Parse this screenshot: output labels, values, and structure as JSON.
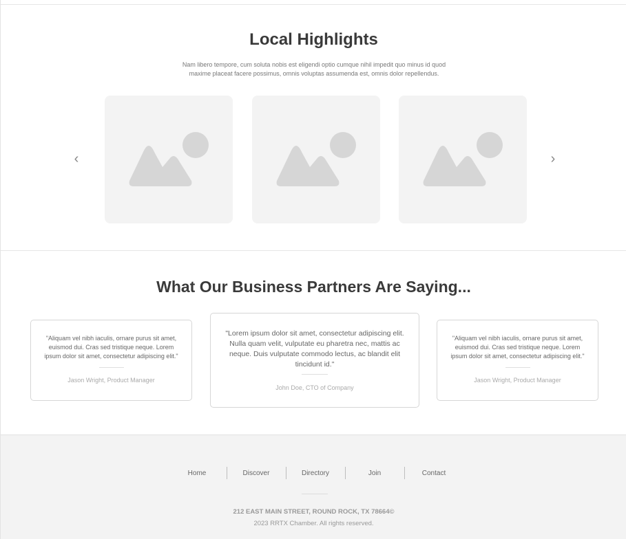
{
  "highlights": {
    "title": "Local Highlights",
    "subtitle": "Nam libero tempore, cum soluta nobis est eligendi optio cumque nihil impedit quo minus id quod maxime placeat facere possimus, omnis voluptas assumenda est, omnis dolor repellendus.",
    "prev_icon": "‹",
    "next_icon": "›",
    "image_icon": "image-placeholder-icon",
    "placeholder_color": "#d6d6d6",
    "card_color": "#f3f3f3"
  },
  "testimonials": {
    "title": "What Our Business Partners Are Saying...",
    "items": [
      {
        "quote": "\"Aliquam vel nibh iaculis, ornare purus sit amet, euismod dui. Cras sed tristique neque. Lorem ipsum dolor sit amet, consectetur adipiscing elit.\"",
        "author": "Jason Wright, Product Manager"
      },
      {
        "quote": "\"Lorem ipsum dolor sit amet, consectetur adipiscing elit. Nulla quam velit, vulputate eu pharetra nec, mattis ac neque. Duis vulputate commodo lectus, ac blandit elit tincidunt id.\"",
        "author": "John Doe, CTO of Company"
      },
      {
        "quote": "\"Aliquam vel nibh iaculis, ornare purus sit amet, euismod dui. Cras sed tristique neque. Lorem ipsum dolor sit amet, consectetur adipiscing elit.\"",
        "author": "Jason Wright, Product Manager"
      }
    ]
  },
  "footer": {
    "nav": [
      "Home",
      "Discover",
      "Directory",
      "Join",
      "Contact"
    ],
    "address": "212 EAST MAIN STREET, ROUND ROCK, TX 78664©",
    "copyright": "2023 RRTX Chamber.  All rights reserved.",
    "background": "#f3f3f3"
  }
}
